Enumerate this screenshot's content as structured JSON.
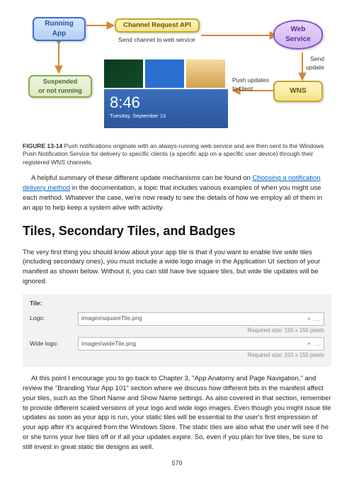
{
  "diagram": {
    "running_app": "Running\nApp",
    "channel_api": "Channel Request API",
    "web_service": "Web\nService",
    "suspended": "Suspended\nor not running",
    "wns": "WNS",
    "send_channel": "Send channel to web service",
    "push_updates": "Push updates\nto client",
    "send_update": "Send\nupdate",
    "lock_time": "8:46",
    "lock_date": "Tuesday, September 13"
  },
  "caption": {
    "label": "FIGURE 13-14",
    "text": " Push notifications originate with an always-running web service and are then sent to the Windows Push Notification Service for delivery to specific clients (a specific app on a specific user device) through their registered WNS channels."
  },
  "para1a": "A helpful summary of these different update mechanisms can be found on ",
  "para1_link": "Choosing a notification delivery method",
  "para1b": " in the documentation, a topic that includes various examples of when you might use each method. Whatever the case, we're now ready to see the details of how we employ all of them in an app to help keep a system alive with activity.",
  "heading": "Tiles, Secondary Tiles, and Badges",
  "para2a": "The very first thing you should know about your app tile is that if you want to enable live ",
  "para2_i": "wide",
  "para2b": " tiles (including secondary ones), you must include a wide logo image in the Application UI section of your manifest as shown below. Without it, you can still have live square tiles, but wide tile updates will be ignored.",
  "manifest": {
    "tile_header": "Tile:",
    "logo_label": "Logo:",
    "logo_value": "images\\squareTile.png",
    "logo_hint": "Required size: 150 x 150 pixels",
    "wide_label": "Wide logo:",
    "wide_value": "images\\wideTile.png",
    "wide_hint": "Required size: 310 x 150 pixels"
  },
  "para3": "At this point I encourage you to go back to Chapter 3, \"App Anatomy and Page Navigation,\" and review the \"Branding Your App 101\" section where we discuss how different bits in the manifest affect your tiles, such as the Short Name and Show Name settings. As also covered in that section, remember to provide different scaled versions of your logo and wide logo images. Even though you might issue tile updates as soon as your app is run, your static tiles will be essential to the user's first impression of your app after it's acquired from the Windows Store. The static tiles are also what the user will see if he or she turns your live tiles off or if all your updates expire. So, even if you plan for live tiles, be sure to still invest in great static tile designs as well.",
  "page_number": "570"
}
